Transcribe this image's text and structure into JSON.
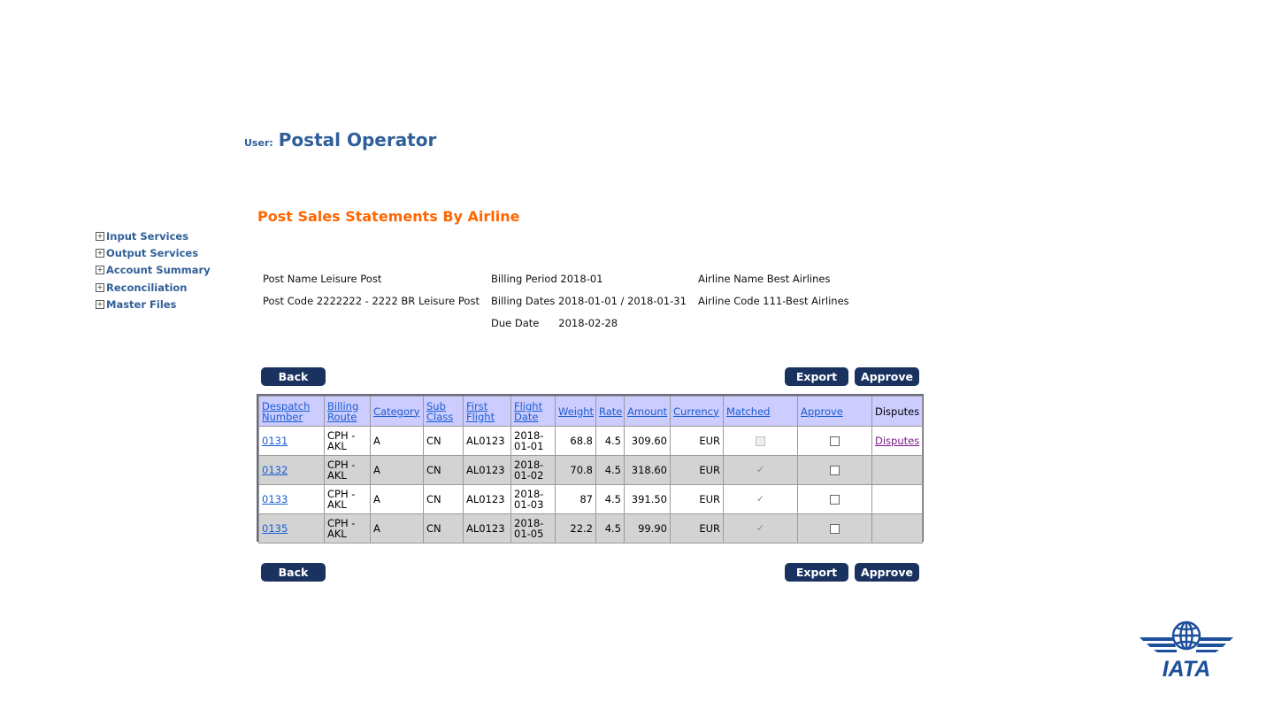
{
  "user": {
    "label": "User:",
    "name": "Postal Operator"
  },
  "page_title": "Post Sales Statements By Airline",
  "nav": [
    {
      "label": "Input Services"
    },
    {
      "label": "Output Services"
    },
    {
      "label": "Account Summary"
    },
    {
      "label": "Reconciliation"
    },
    {
      "label": "Master Files"
    }
  ],
  "info": {
    "post_name": "Post Name Leisure Post",
    "post_code": "Post Code  2222222 - 2222 BR Leisure Post",
    "billing_period": "Billing Period 2018-01",
    "billing_dates": "Billing Dates  2018-01-01 / 2018-01-31",
    "due_date": "Due Date      2018-02-28",
    "airline_name": "Airline Name Best Airlines",
    "airline_code": "Airline Code  111-Best Airlines"
  },
  "buttons": {
    "back": "Back",
    "export": "Export",
    "approve": "Approve"
  },
  "table": {
    "headers": {
      "despatch_1": "Despatch",
      "despatch_2": "Number",
      "route_1": "Billing",
      "route_2": "Route",
      "category": "Category",
      "sub_1": "Sub",
      "sub_2": "Class",
      "first_1": "First",
      "first_2": "Flight",
      "fdate_1": "Flight",
      "fdate_2": "Date",
      "weight": "Weight",
      "rate": "Rate",
      "amount": "Amount",
      "currency": "Currency",
      "matched": "Matched",
      "approve": "Approve",
      "disputes": "Disputes"
    },
    "rows": [
      {
        "despatch": "0131",
        "route_1": "CPH -",
        "route_2": "AKL",
        "category": "A",
        "sub_class": "CN",
        "first_flight": "AL0123",
        "date_1": "2018-",
        "date_2": "01-01",
        "weight": "68.8",
        "rate": "4.5",
        "amount": "309.60",
        "currency": "EUR",
        "matched": false,
        "disputes": "Disputes"
      },
      {
        "despatch": "0132",
        "route_1": "CPH -",
        "route_2": "AKL",
        "category": "A",
        "sub_class": "CN",
        "first_flight": "AL0123",
        "date_1": "2018-",
        "date_2": "01-02",
        "weight": "70.8",
        "rate": "4.5",
        "amount": "318.60",
        "currency": "EUR",
        "matched": true,
        "disputes": ""
      },
      {
        "despatch": "0133",
        "route_1": "CPH -",
        "route_2": "AKL",
        "category": "A",
        "sub_class": "CN",
        "first_flight": "AL0123",
        "date_1": "2018-",
        "date_2": "01-03",
        "weight": "87",
        "rate": "4.5",
        "amount": "391.50",
        "currency": "EUR",
        "matched": true,
        "disputes": ""
      },
      {
        "despatch": "0135",
        "route_1": "CPH -",
        "route_2": "AKL",
        "category": "A",
        "sub_class": "CN",
        "first_flight": "AL0123",
        "date_1": "2018-",
        "date_2": "01-05",
        "weight": "22.2",
        "rate": "4.5",
        "amount": "99.90",
        "currency": "EUR",
        "matched": true,
        "disputes": ""
      }
    ]
  },
  "logo": {
    "text": "IATA",
    "color": "#1c4f9c"
  },
  "colors": {
    "accent_orange": "#ff6600",
    "nav_blue": "#2f5f98",
    "button_navy": "#1a3260",
    "header_lavender": "#ccccff",
    "alt_row": "#d3d3d3"
  }
}
